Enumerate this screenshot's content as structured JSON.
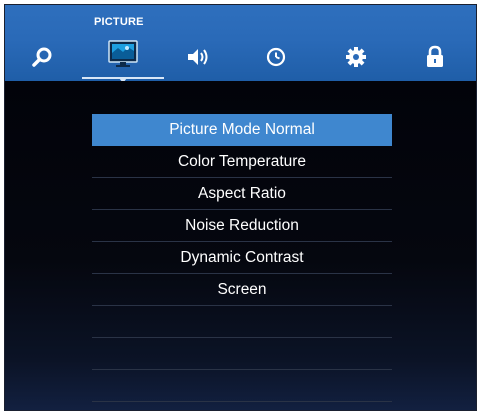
{
  "header": {
    "title": "PICTURE",
    "tabs": [
      {
        "icon": "search-icon",
        "active": false
      },
      {
        "icon": "picture-icon",
        "active": true
      },
      {
        "icon": "sound-icon",
        "active": false
      },
      {
        "icon": "clock-icon",
        "active": false
      },
      {
        "icon": "gear-icon",
        "active": false
      },
      {
        "icon": "lock-icon",
        "active": false
      }
    ]
  },
  "menu": {
    "selected_index": 0,
    "items": [
      {
        "label": "Picture Mode Normal"
      },
      {
        "label": "Color Temperature"
      },
      {
        "label": "Aspect Ratio"
      },
      {
        "label": "Noise Reduction"
      },
      {
        "label": "Dynamic Contrast"
      },
      {
        "label": "Screen"
      }
    ]
  },
  "colors": {
    "header_bg": "#2a6ab8",
    "highlight": "#3f87cf",
    "body_bg": "#05070f",
    "text": "#ffffff"
  }
}
